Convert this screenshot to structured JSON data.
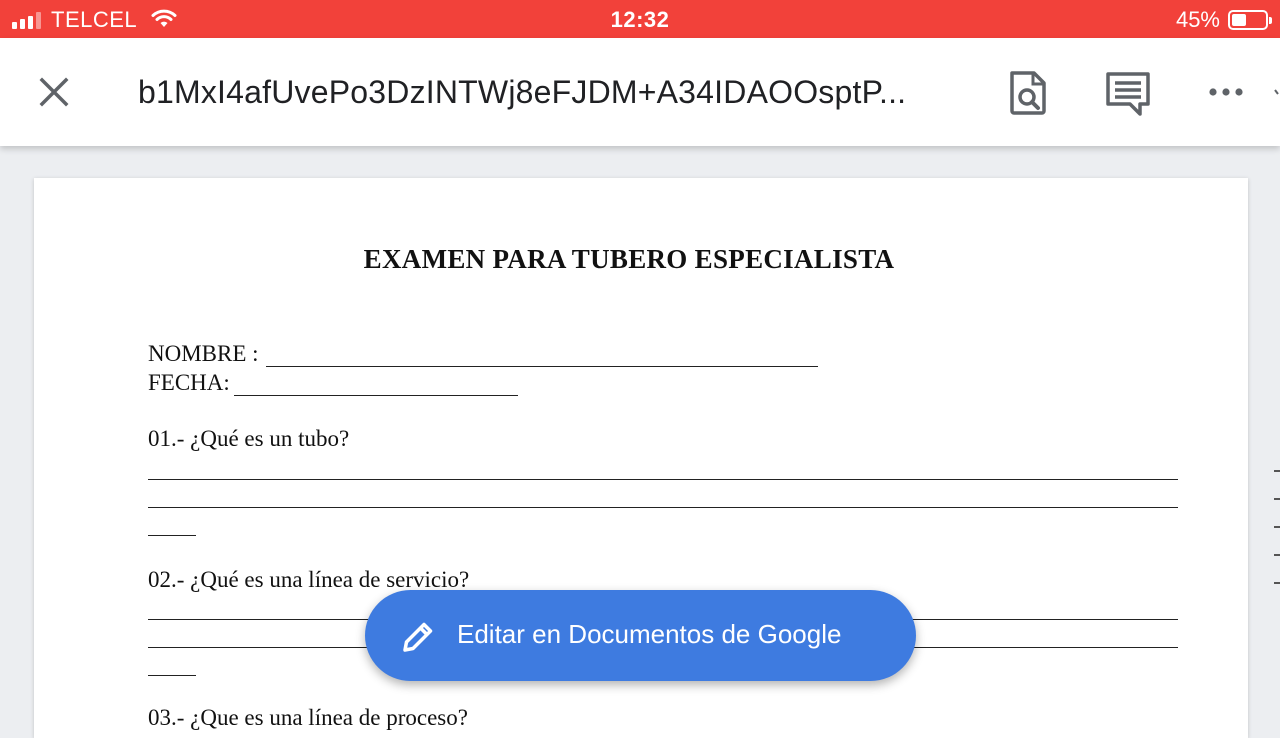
{
  "status_bar": {
    "carrier": "TELCEL",
    "time": "12:32",
    "battery": "45%",
    "battery_level": 0.45
  },
  "app_bar": {
    "title": "b1MxI4afUvePo3DzINTWj8eFJDM+A34IDAOOsptP..."
  },
  "document": {
    "heading": "EXAMEN PARA TUBERO ESPECIALISTA",
    "nombre_label": "NOMBRE :",
    "fecha_label": "FECHA:",
    "q1": "01.- ¿Qué es un tubo?",
    "q2": "02.- ¿Qué es una línea de servicio?",
    "q3": "03.- ¿Que es una línea de proceso?"
  },
  "fab": {
    "label": "Editar en Documentos de Google"
  },
  "colors": {
    "status_bar": "#f2413a",
    "fab": "#3e7be0"
  }
}
